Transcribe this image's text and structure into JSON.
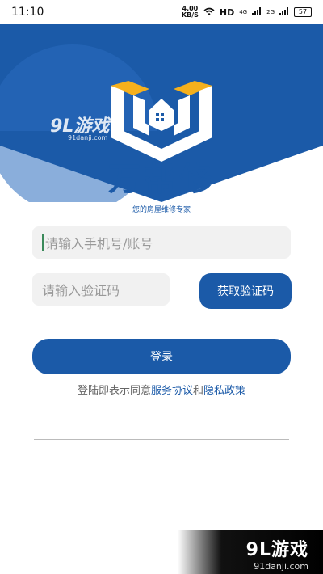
{
  "status_bar": {
    "time": "11:10",
    "speed_value": "4.00",
    "speed_unit": "KB/S",
    "network": "HD",
    "signal1": "4G",
    "signal2": "2G",
    "battery": "57"
  },
  "brand": {
    "name": "万帮修",
    "slogan": "您的房屋维修专家"
  },
  "form": {
    "phone_placeholder": "请输入手机号/账号",
    "code_placeholder": "请输入验证码",
    "get_code_label": "获取验证码",
    "login_label": "登录"
  },
  "agreement": {
    "prefix": "登陆即表示同意",
    "service_link": "服务协议",
    "and": "和",
    "privacy_link": "隐私政策"
  },
  "watermark": {
    "brand": "9L游戏",
    "url": "91danji.com"
  },
  "colors": {
    "primary": "#1b5aa8",
    "accent": "#f5b01d"
  }
}
